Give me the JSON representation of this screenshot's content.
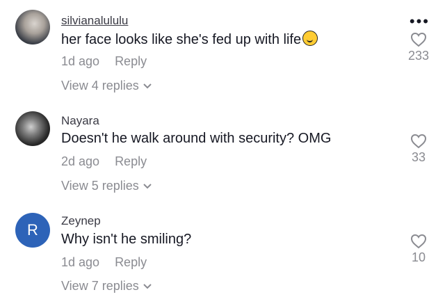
{
  "comments": [
    {
      "username": "silvianalululu",
      "text": "her face looks like she's fed up with life",
      "time": "1d ago",
      "reply": "Reply",
      "view_replies": "View 4 replies",
      "likes": "233"
    },
    {
      "username": "Nayara",
      "text": "Doesn't he walk around with security? OMG",
      "time": "2d ago",
      "reply": "Reply",
      "view_replies": "View 5 replies",
      "likes": "33"
    },
    {
      "username": "Zeynep",
      "avatar_letter": "R",
      "text": "Why isn't he smiling?",
      "time": "1d ago",
      "reply": "Reply",
      "view_replies": "View 7 replies",
      "likes": "10"
    }
  ],
  "more_label": "•••",
  "icons": {
    "like": "heart-outline-icon",
    "expand": "chevron-down-icon",
    "more": "more-dots-icon",
    "emoji": "rolling-laughing-emoji"
  },
  "colors": {
    "text": "#161823",
    "muted": "#8a8b91",
    "avatar_blue": "#2d63b8"
  }
}
